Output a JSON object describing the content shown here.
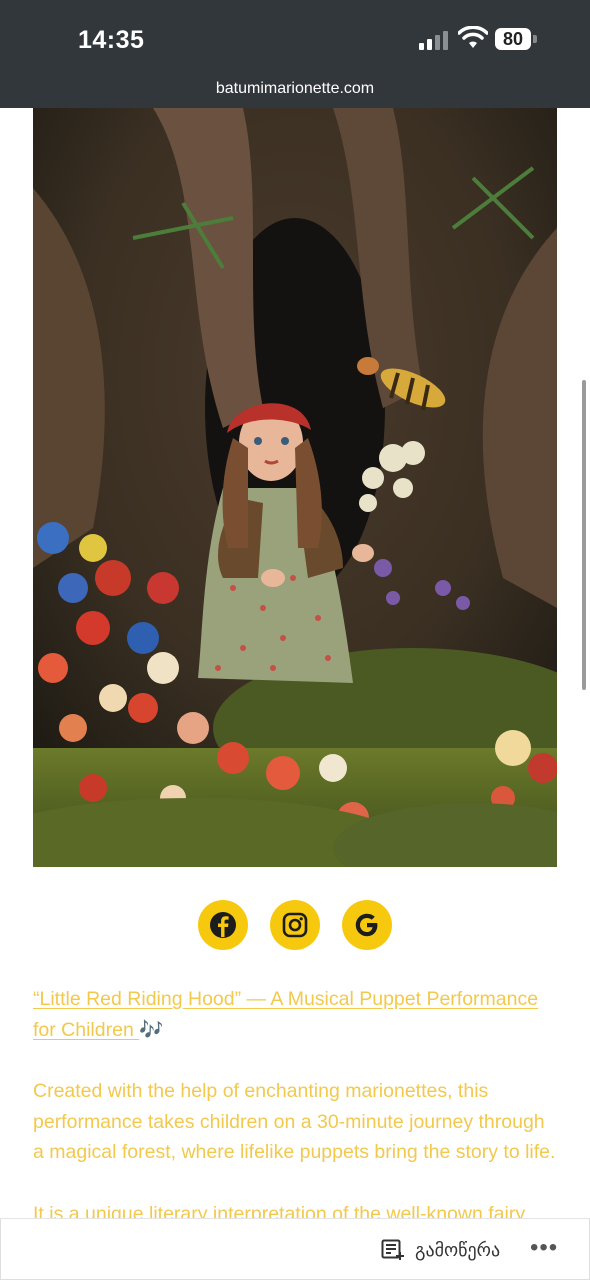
{
  "status_bar": {
    "time": "14:35",
    "battery": "80",
    "url": "batumimarionette.com"
  },
  "hero": {
    "alt": "Marionette of Little Red Riding Hood standing among flowers and moss with a bee flying nearby"
  },
  "social": [
    {
      "name": "facebook",
      "icon": "facebook-icon"
    },
    {
      "name": "instagram",
      "icon": "instagram-icon"
    },
    {
      "name": "google",
      "icon": "google-icon"
    }
  ],
  "article": {
    "title_link": "“Little Red Riding Hood” — A Musical Puppet Performance for Children ",
    "title_emoji": "🎶",
    "paragraph1": "Created with the help of enchanting marionettes, this performance takes children on a 30-minute journey through a magical forest, where lifelike puppets bring the story to life.",
    "paragraph2": "It is a unique literary interpretation of the well-known fairy tale"
  },
  "bottom_bar": {
    "subscribe_label": "გამოწერა",
    "more_label": "•••"
  },
  "colors": {
    "accent": "#f6c90e",
    "text_yellow": "#f2c94c",
    "statusbar_bg": "#32373c"
  }
}
